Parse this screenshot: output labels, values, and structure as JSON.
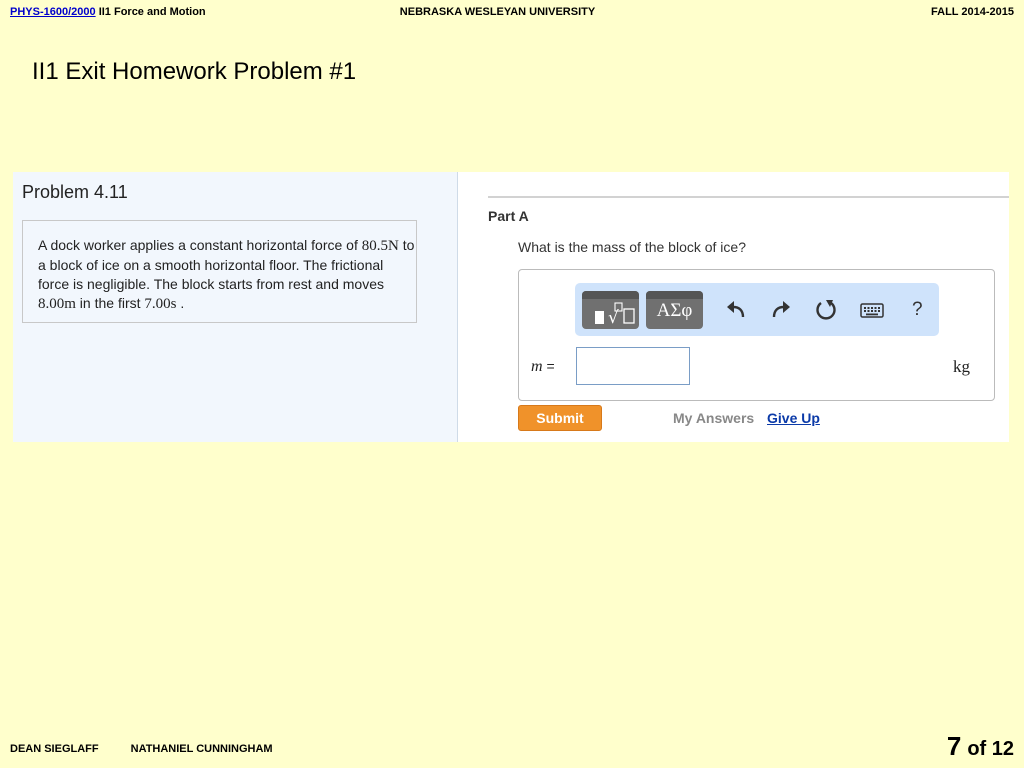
{
  "header": {
    "course_code": "PHYS-1600/2000",
    "course_topic": "II1 Force and Motion",
    "university": "NEBRASKA WESLEYAN UNIVERSITY",
    "term": "FALL 2014-2015"
  },
  "slide_title": "II1 Exit Homework Problem #1",
  "problem": {
    "title": "Problem 4.11",
    "text_1": "A dock worker applies a constant horizontal force of ",
    "force_value": "80.5N",
    "text_2": " to a block of ice on a smooth horizontal floor. The frictional force is negligible. The block starts from rest and moves ",
    "distance_value": "8.00m",
    "text_3": " in the first ",
    "time_value": "7.00s",
    "text_4": " ."
  },
  "part": {
    "label": "Part A",
    "question": "What is the mass of the block of ice?",
    "toolbar": {
      "symbols_label": "ΑΣφ",
      "icons": [
        "templates-icon",
        "undo-icon",
        "redo-icon",
        "reset-icon",
        "keyboard-icon",
        "help-icon"
      ],
      "help_label": "?"
    },
    "variable_label": "m",
    "equals": " =",
    "answer_value": "",
    "unit": "kg",
    "submit_label": "Submit",
    "my_answers_label": "My Answers",
    "give_up_label": "Give Up"
  },
  "footer": {
    "author_1": "DEAN SIEGLAFF",
    "author_2": "NATHANIEL CUNNINGHAM",
    "page_current": "7",
    "page_total": "of 12"
  },
  "colors": {
    "page_bg": "#ffffcc",
    "submit_bg": "#f0922a",
    "toolbar_bg": "#cfe3fb",
    "link": "#0b3aa8"
  }
}
